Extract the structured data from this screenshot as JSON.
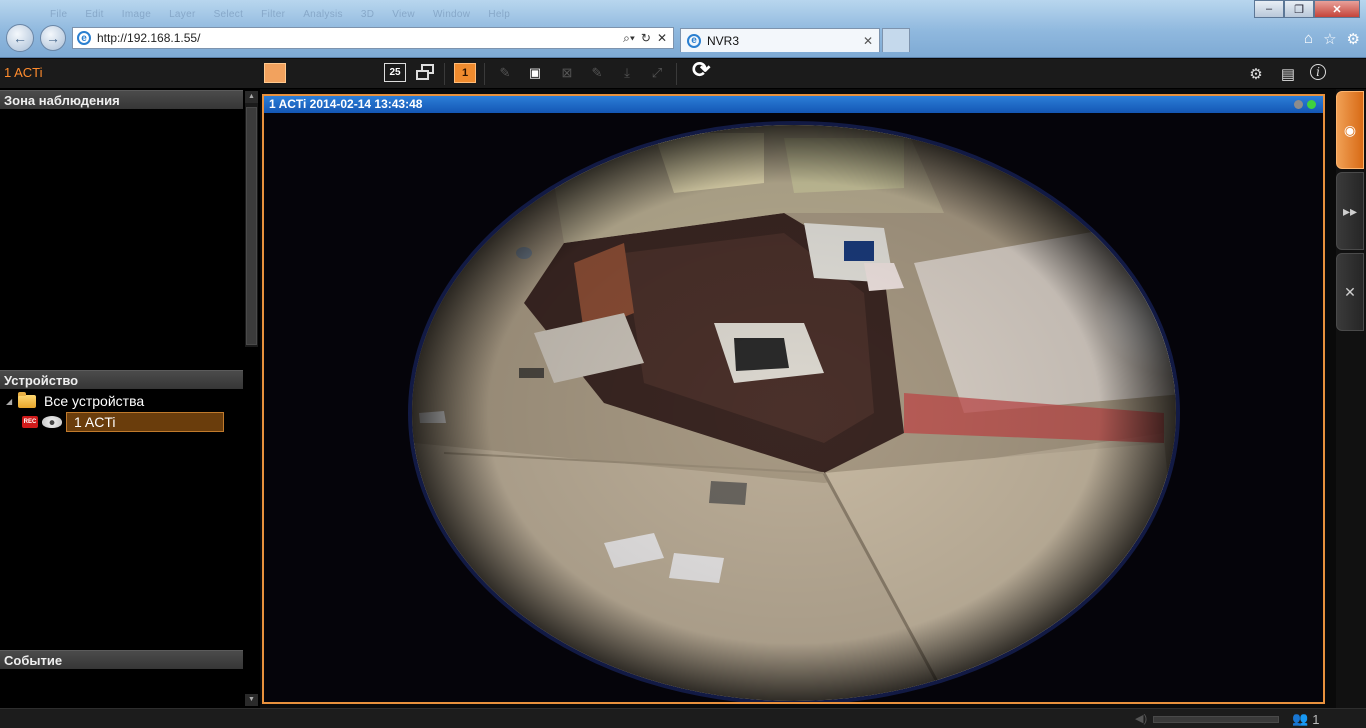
{
  "browser": {
    "menu_ghost": [
      "File",
      "Edit",
      "Image",
      "Layer",
      "Select",
      "Filter",
      "Analysis",
      "3D",
      "View",
      "Window",
      "Help"
    ],
    "address": "http://192.168.1.55/",
    "tab_title": "NVR3",
    "icons": [
      "back-arrow-icon",
      "forward-arrow-icon",
      "ie-logo-icon",
      "search-icon",
      "refresh-icon",
      "home-icon",
      "star-icon",
      "gear-icon"
    ]
  },
  "app": {
    "title": "1 ACTi",
    "layout_count_label": "25",
    "page_number": "1"
  },
  "left_panel": {
    "zone_header": "Зона наблюдения",
    "device_header": "Устройство",
    "event_header": "Событие",
    "tree_root": "Все устройства",
    "tree_device": "1 ACTi",
    "rec_label": "REC"
  },
  "video": {
    "title": "1 ACTi   2014-02-14 13:43:48",
    "accent": "#e8913d",
    "bar_color": "#1e6bc8"
  },
  "status_bar": {
    "user_count": "1"
  }
}
